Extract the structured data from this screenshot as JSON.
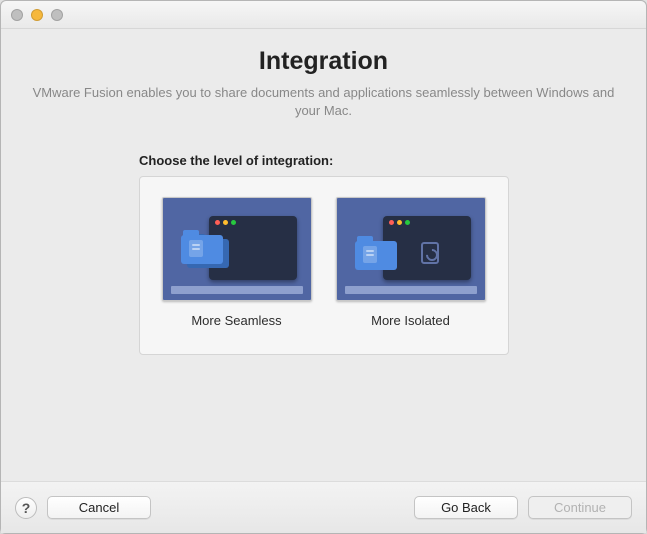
{
  "header": {
    "title": "Integration",
    "subtitle": "VMware Fusion enables you to share documents and applications seamlessly between Windows and your Mac."
  },
  "main": {
    "prompt": "Choose the level of integration:",
    "options": [
      {
        "label": "More Seamless"
      },
      {
        "label": "More Isolated"
      }
    ]
  },
  "footer": {
    "help_glyph": "?",
    "cancel_label": "Cancel",
    "back_label": "Go Back",
    "continue_label": "Continue",
    "continue_enabled": false
  }
}
